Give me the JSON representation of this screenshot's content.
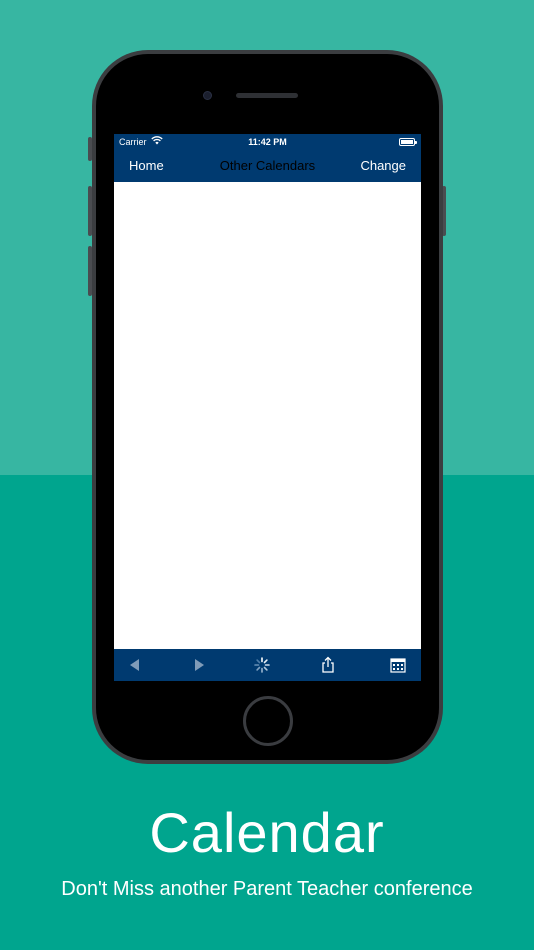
{
  "status_bar": {
    "carrier": "Carrier",
    "time": "11:42 PM"
  },
  "nav_bar": {
    "left_button": "Home",
    "title": "Other Calendars",
    "right_button": "Change"
  },
  "toolbar": {
    "icons": [
      "back-icon",
      "forward-icon",
      "loading-spinner-icon",
      "share-icon",
      "calendar-icon"
    ]
  },
  "caption": {
    "title": "Calendar",
    "subtitle": "Don't Miss another Parent Teacher conference"
  },
  "colors": {
    "background_top": "#37b6a2",
    "background_bottom": "#00a58e",
    "bar": "#003a70"
  }
}
